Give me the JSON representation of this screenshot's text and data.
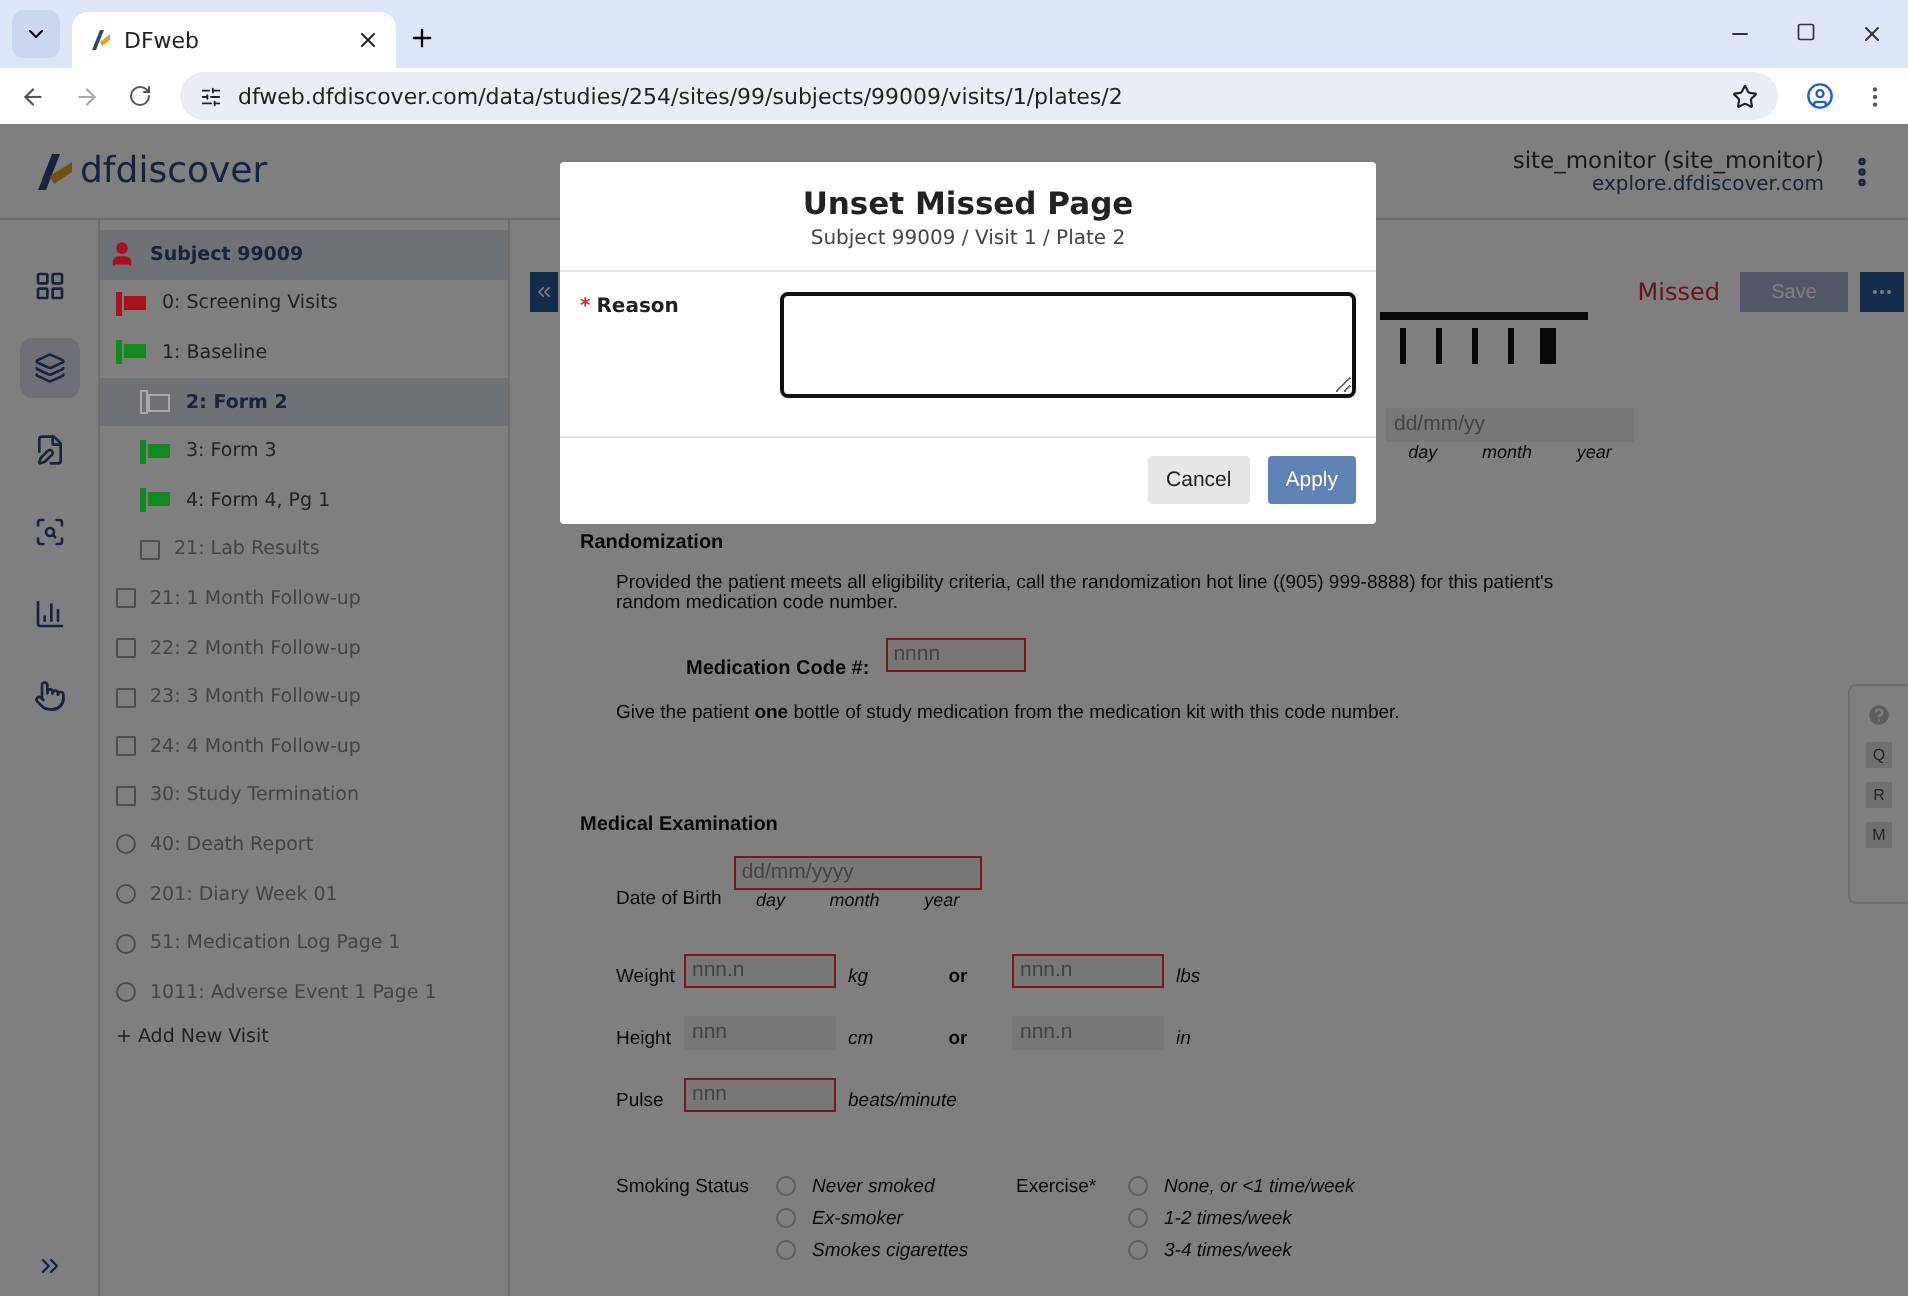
{
  "browser": {
    "tab_title": "DFweb",
    "url": "dfweb.dfdiscover.com/data/studies/254/sites/99/subjects/99009/visits/1/plates/2"
  },
  "header": {
    "logo": "dfdiscover",
    "user": "site_monitor (site_monitor)",
    "server": "explore.dfdiscover.com"
  },
  "rail": [
    {
      "selected": false
    },
    {
      "selected": true
    },
    {
      "selected": false
    },
    {
      "selected": false
    },
    {
      "selected": false
    },
    {
      "selected": false
    }
  ],
  "tree": {
    "subject": {
      "label": "Subject 99009",
      "color": "#a8121a"
    },
    "items": [
      {
        "label": "0: Screening Visits",
        "kind": "flag",
        "color": "#a8121a",
        "selected": false
      },
      {
        "label": "1: Baseline",
        "kind": "flag",
        "color": "#108a1e",
        "selected": false,
        "children": [
          {
            "label": "2: Form 2",
            "kind": "outline",
            "selected": true
          },
          {
            "label": "3: Form 3",
            "kind": "flag",
            "color": "#108a1e",
            "selected": false
          },
          {
            "label": "4: Form 4, Pg 1",
            "kind": "flag",
            "color": "#108a1e",
            "selected": false
          },
          {
            "label": "21: Lab Results",
            "kind": "square",
            "selected": false
          }
        ]
      },
      {
        "label": "21: 1 Month Follow-up",
        "kind": "square",
        "selected": false
      },
      {
        "label": "22: 2 Month Follow-up",
        "kind": "square",
        "selected": false
      },
      {
        "label": "23: 3 Month Follow-up",
        "kind": "square",
        "selected": false
      },
      {
        "label": "24: 4 Month Follow-up",
        "kind": "square",
        "selected": false
      },
      {
        "label": "30: Study Termination",
        "kind": "square",
        "selected": false
      },
      {
        "label": "40: Death Report",
        "kind": "circle",
        "selected": false
      },
      {
        "label": "201: Diary Week 01",
        "kind": "circle",
        "selected": false
      },
      {
        "label": "51: Medication Log Page 1",
        "kind": "circle",
        "selected": false
      },
      {
        "label": "1011: Adverse Event 1 Page 1",
        "kind": "circle",
        "selected": false
      }
    ],
    "add_label": "+ Add New Visit"
  },
  "form": {
    "status": "Missed",
    "save": {
      "label": "Save",
      "disabled": true
    },
    "visit_date": {
      "placeholder": "dd/mm/yy",
      "parts": [
        "day",
        "month",
        "year"
      ]
    },
    "randomization": {
      "heading": "Randomization",
      "text": "Provided the patient meets all eligibility criteria, call the randomization hot line ((905) 999-8888) for this patient's random medication code number.",
      "code_label": "Medication Code #:",
      "code": {
        "placeholder": "nnnn",
        "flagged": true
      },
      "instruction": "Give the patient **one** bottle of study medication from the medication kit with this code number."
    },
    "exam": {
      "heading": "Medical Examination",
      "dob_label": "Date of Birth",
      "dob": {
        "placeholder": "dd/mm/yyyy",
        "flagged": true
      },
      "dob_parts": [
        "day",
        "month",
        "year"
      ],
      "measures": [
        {
          "label": "Weight",
          "a": {
            "placeholder": "nnn.n",
            "flagged": true
          },
          "a_unit": "kg",
          "or": "or",
          "b": {
            "placeholder": "nnn.n",
            "flagged": true
          },
          "b_unit": "lbs"
        },
        {
          "label": "Height",
          "a": {
            "placeholder": "nnn",
            "flagged": false
          },
          "a_unit": "cm",
          "or": "or",
          "b": {
            "placeholder": "nnn.n",
            "flagged": false
          },
          "b_unit": "in"
        },
        {
          "label": "Pulse",
          "a": {
            "placeholder": "nnn",
            "flagged": true
          },
          "a_unit": "beats/minute"
        }
      ],
      "smoking": {
        "label": "Smoking Status",
        "options": [
          {
            "label": "Never smoked",
            "selected": false
          },
          {
            "label": "Ex-smoker",
            "selected": false
          },
          {
            "label": "Smokes cigarettes",
            "selected": false
          }
        ]
      },
      "exercise": {
        "label": "Exercise*",
        "options": [
          {
            "label": "None, or <1 time/week",
            "selected": false
          },
          {
            "label": "1-2 times/week",
            "selected": false
          },
          {
            "label": "3-4 times/week",
            "selected": false
          }
        ]
      }
    },
    "side_tools": [
      "Q",
      "R",
      "M"
    ]
  },
  "dialog": {
    "title": "Unset Missed Page",
    "subtitle": "Subject 99009 / Visit 1 / Plate 2",
    "required_mark": "*",
    "reason_label": "Reason",
    "buttons": [
      {
        "label": "Cancel",
        "kind": "secondary"
      },
      {
        "label": "Apply",
        "kind": "primary"
      }
    ]
  }
}
